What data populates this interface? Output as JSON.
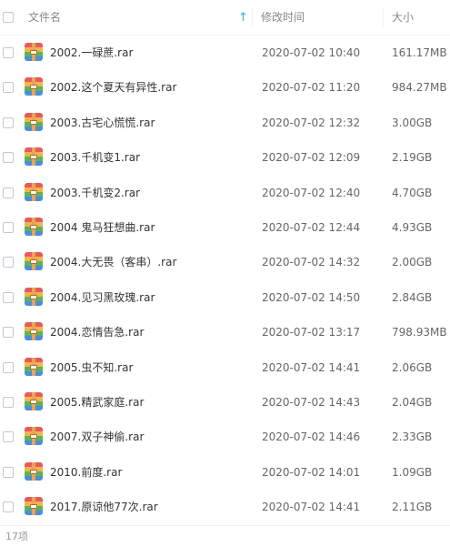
{
  "header": {
    "name_label": "文件名",
    "date_label": "修改时间",
    "size_label": "大小",
    "sort_indicator": "↑"
  },
  "files": [
    {
      "name": "2002.一碌蔗.rar",
      "date": "2020-07-02 10:40",
      "size": "161.17MB"
    },
    {
      "name": "2002.这个夏天有异性.rar",
      "date": "2020-07-02 11:20",
      "size": "984.27MB"
    },
    {
      "name": "2003.古宅心慌慌.rar",
      "date": "2020-07-02 12:32",
      "size": "3.00GB"
    },
    {
      "name": "2003.千机变1.rar",
      "date": "2020-07-02 12:09",
      "size": "2.19GB"
    },
    {
      "name": "2003.千机变2.rar",
      "date": "2020-07-02 12:40",
      "size": "4.70GB"
    },
    {
      "name": "2004 鬼马狂想曲.rar",
      "date": "2020-07-02 12:44",
      "size": "4.93GB"
    },
    {
      "name": "2004.大无畏（客串）.rar",
      "date": "2020-07-02 14:32",
      "size": "2.00GB"
    },
    {
      "name": "2004.见习黑玫瑰.rar",
      "date": "2020-07-02 14:50",
      "size": "2.84GB"
    },
    {
      "name": "2004.恋情告急.rar",
      "date": "2020-07-02 13:17",
      "size": "798.93MB"
    },
    {
      "name": "2005.虫不知.rar",
      "date": "2020-07-02 14:41",
      "size": "2.06GB"
    },
    {
      "name": "2005.精武家庭.rar",
      "date": "2020-07-02 14:43",
      "size": "2.04GB"
    },
    {
      "name": "2007.双子神偷.rar",
      "date": "2020-07-02 14:46",
      "size": "2.33GB"
    },
    {
      "name": "2010.前度.rar",
      "date": "2020-07-02 14:01",
      "size": "1.09GB"
    },
    {
      "name": "2017.原谅他77次.rar",
      "date": "2020-07-02 14:41",
      "size": "2.11GB"
    }
  ],
  "icon": {
    "name": "rar-archive-icon",
    "colors": [
      "#e85a5a",
      "#f0b54a",
      "#5bb35b",
      "#4a8fd6"
    ]
  },
  "footer": {
    "count_label": "17项"
  }
}
